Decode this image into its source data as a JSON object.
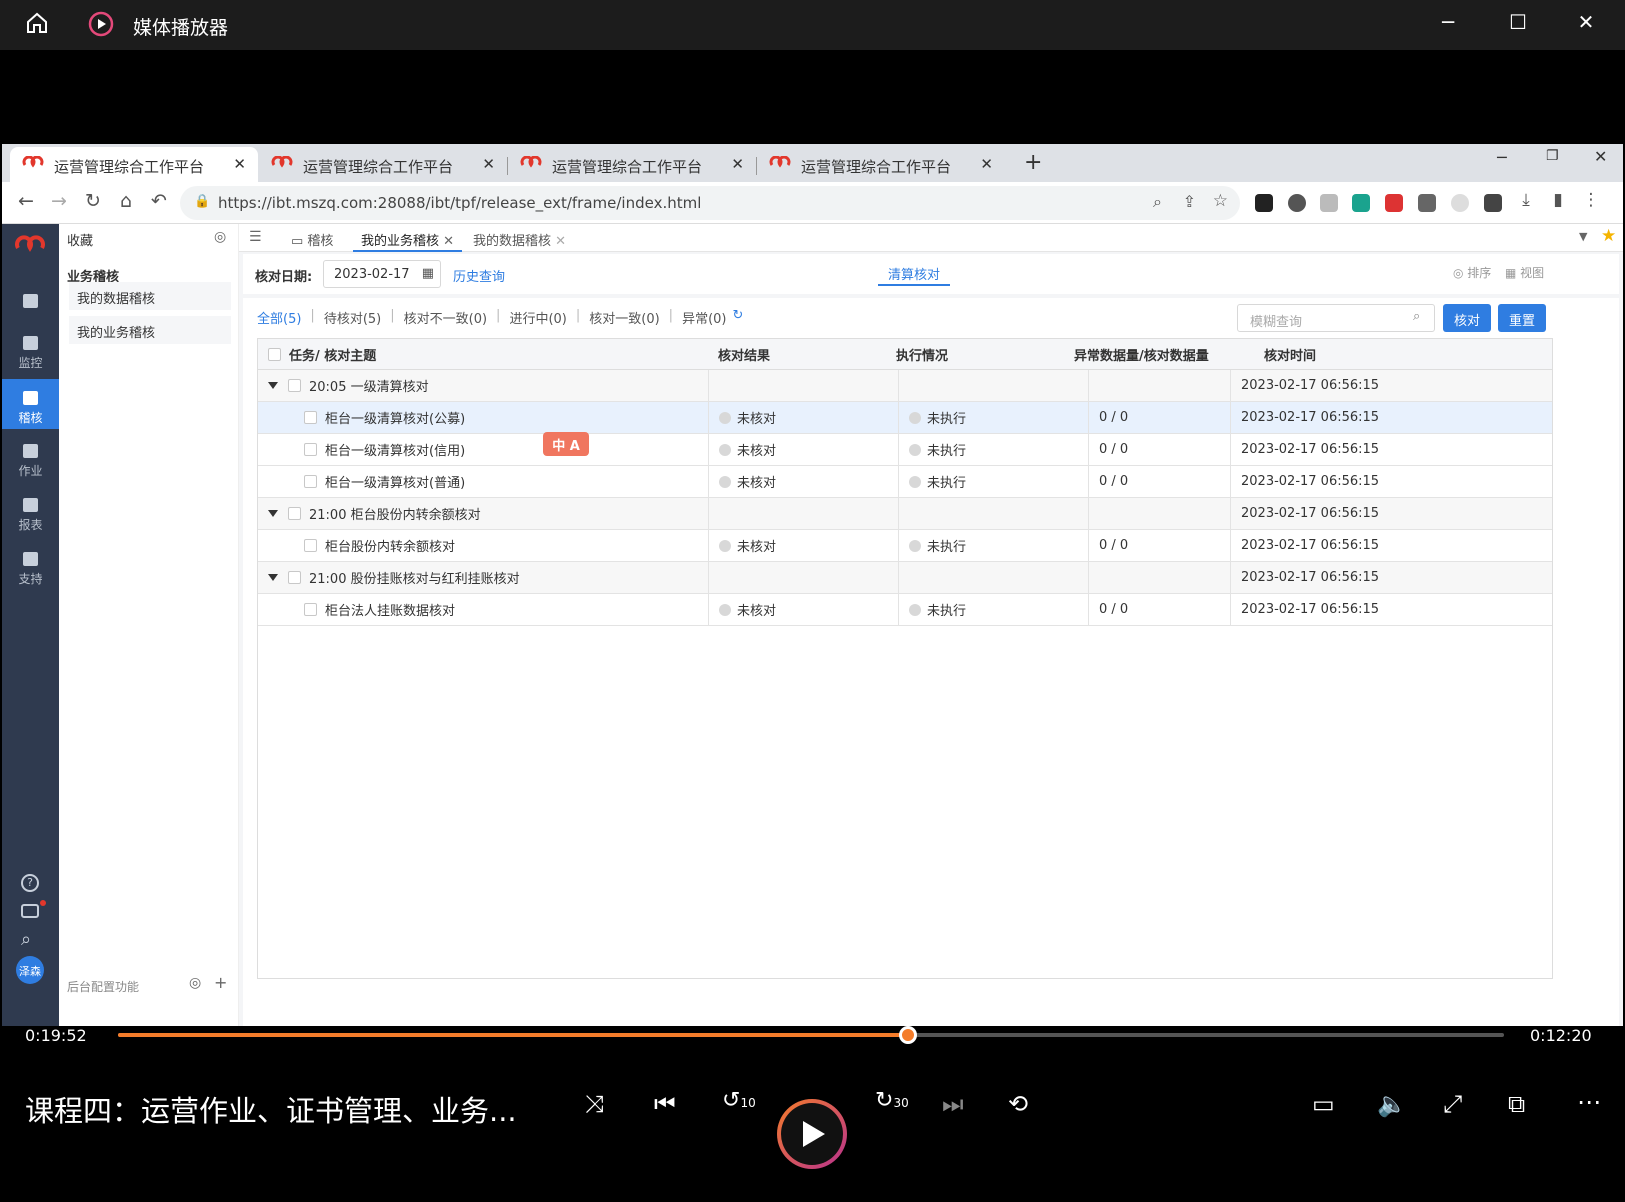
{
  "player_title": "媒体播放器",
  "browser": {
    "tabs": [
      {
        "label": "运营管理综合工作平台"
      },
      {
        "label": "运营管理综合工作平台"
      },
      {
        "label": "运营管理综合工作平台"
      },
      {
        "label": "运营管理综合工作平台"
      }
    ],
    "url": "https://ibt.mszq.com:28088/ibt/tpf/release_ext/frame/index.html"
  },
  "leftnav": {
    "items": [
      {
        "label": "监控",
        "icon": "monitor-icon"
      },
      {
        "label": "稽核",
        "icon": "audit-icon"
      },
      {
        "label": "作业",
        "icon": "job-icon"
      },
      {
        "label": "报表",
        "icon": "report-icon"
      },
      {
        "label": "支持",
        "icon": "support-icon"
      }
    ],
    "avatar": "泽森"
  },
  "sidepanel": {
    "favorites": "收藏",
    "section": "业务稽核",
    "items": [
      "我的数据稽核",
      "我的业务稽核"
    ],
    "footer": "后台配置功能"
  },
  "pagetabs": [
    {
      "label": "稽核"
    },
    {
      "label": "我的业务稽核"
    },
    {
      "label": "我的数据稽核"
    }
  ],
  "filter": {
    "date_label": "核对日期:",
    "date_value": "2023-02-17",
    "history": "历史查询",
    "center_tab": "清算核对",
    "sort": "排序",
    "view": "视图"
  },
  "query_tabs": [
    "全部(5)",
    "待核对(5)",
    "核对不一致(0)",
    "进行中(0)",
    "核对一致(0)",
    "异常(0)"
  ],
  "search_placeholder": "模糊查询",
  "buttons": {
    "check": "核对",
    "reset": "重置"
  },
  "table": {
    "columns": [
      "任务/ 核对主题",
      "核对结果",
      "执行情况",
      "异常数据量/核对数据量",
      "核对时间"
    ],
    "rows": [
      {
        "type": "group",
        "name": "20:05 一级清算核对",
        "time": "2023-02-17 06:56:15"
      },
      {
        "type": "item",
        "name": "柜台一级清算核对(公募)",
        "result": "未核对",
        "status": "未执行",
        "count": "0 / 0",
        "time": "2023-02-17 06:56:15"
      },
      {
        "type": "item",
        "name": "柜台一级清算核对(信用)",
        "result": "未核对",
        "status": "未执行",
        "count": "0 / 0",
        "time": "2023-02-17 06:56:15"
      },
      {
        "type": "item",
        "name": "柜台一级清算核对(普通)",
        "result": "未核对",
        "status": "未执行",
        "count": "0 / 0",
        "time": "2023-02-17 06:56:15"
      },
      {
        "type": "group",
        "name": "21:00 柜台股份内转余额核对",
        "time": "2023-02-17 06:56:15"
      },
      {
        "type": "item",
        "name": "柜台股份内转余额核对",
        "result": "未核对",
        "status": "未执行",
        "count": "0 / 0",
        "time": "2023-02-17 06:56:15"
      },
      {
        "type": "group",
        "name": "21:00 股份挂账核对与红利挂账核对",
        "time": "2023-02-17 06:56:15"
      },
      {
        "type": "item",
        "name": "柜台法人挂账数据核对",
        "result": "未核对",
        "status": "未执行",
        "count": "0 / 0",
        "time": "2023-02-17 06:56:15"
      }
    ]
  },
  "ime_badge": "中 A",
  "video": {
    "elapsed": "0:19:52",
    "remaining": "0:12:20",
    "progress": 0.57,
    "title": "课程四：运营作业、证书管理、业务...",
    "rewind_seconds": "10",
    "forward_seconds": "30"
  },
  "colors": {
    "accent": "#2f7de1",
    "player_accent": "#f47c2a",
    "brand": "#e2372c"
  }
}
